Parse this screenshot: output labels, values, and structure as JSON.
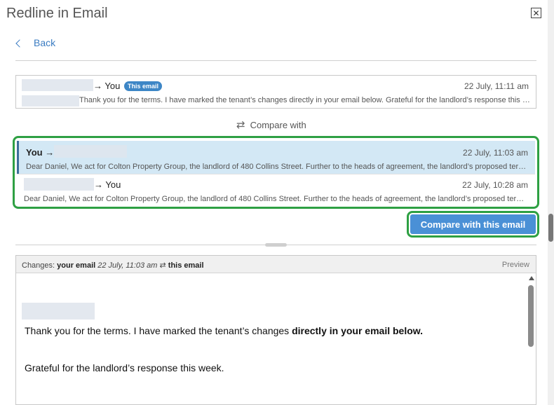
{
  "window": {
    "title": "Redline in Email"
  },
  "nav": {
    "back_label": "Back"
  },
  "current_email": {
    "arrow_to": "→ You",
    "badge": "This email",
    "time": "22 July, 11:11 am",
    "preview": "Thank you for the terms. I have marked the tenant’s changes directly in your email below. Grateful for the landlord’s response this week."
  },
  "compare": {
    "label": "Compare with",
    "options": [
      {
        "from_label": "You →",
        "time": "22 July, 11:03 am",
        "preview": "Dear Daniel, We act for Colton Property Group, the landlord of 480 Collins Street. Further to the heads of agreement, the landlord’s proposed terms are set out below."
      },
      {
        "arrow_to": "→ You",
        "time": "22 July, 10:28 am",
        "preview": "Dear Daniel, We act for Colton Property Group, the landlord of 480 Collins Street. Further to the heads of agreement, the landlord’s proposed terms are set out below."
      }
    ],
    "button_label": "Compare with this email"
  },
  "changes": {
    "prefix": "Changes:",
    "your_email": "your email",
    "date": "22 July, 11:03 am",
    "swap": "⇄",
    "this_email": "this email",
    "preview_label": "Preview",
    "para1_plain": "Thank you for the terms. I have marked the tenant’s changes ",
    "para1_bold": "directly in your email below.",
    "para2": "Grateful for the landlord’s response this week."
  },
  "icons": {
    "close": "close-icon",
    "back": "chevron-left-icon",
    "compare": "swap-arrows-icon"
  },
  "colors": {
    "accent": "#4a90d6",
    "highlight_border": "#2ea043",
    "selected_bg": "#d3e8f5",
    "badge": "#3d86c6"
  }
}
